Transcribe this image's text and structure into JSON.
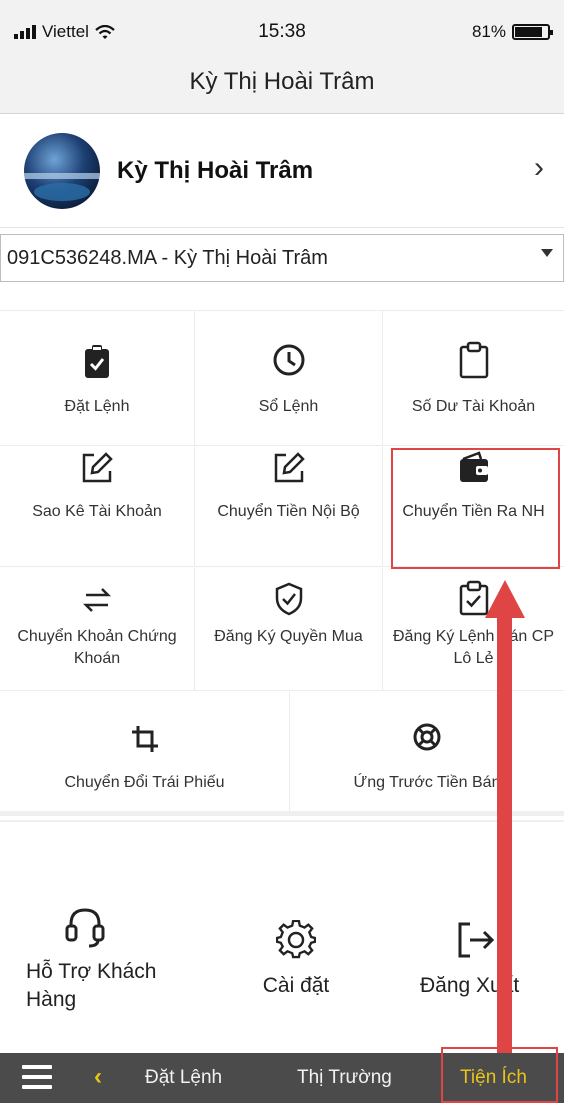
{
  "status_bar": {
    "carrier": "Viettel",
    "time": "15:38",
    "battery": "81%"
  },
  "header": {
    "title": "Kỳ Thị Hoài Trâm"
  },
  "profile": {
    "name": "Kỳ Thị Hoài Trâm"
  },
  "account": {
    "selected": "091C536248.MA - Kỳ Thị Hoài Trâm"
  },
  "grid": {
    "row1": [
      {
        "label": "Đặt Lệnh",
        "icon": "clipboard-check-icon"
      },
      {
        "label": "Sổ Lệnh",
        "icon": "clock-icon"
      },
      {
        "label": "Số Dư Tài Khoản",
        "icon": "clipboard-icon"
      }
    ],
    "row2": [
      {
        "label": "Sao Kê Tài Khoản",
        "icon": "edit-icon"
      },
      {
        "label": "Chuyển Tiền Nội Bộ",
        "icon": "edit-icon"
      },
      {
        "label": "Chuyển Tiền Ra NH",
        "icon": "wallet-icon"
      }
    ],
    "row3": [
      {
        "label": "Chuyển Khoản Chứng Khoán",
        "icon": "transfer-arrows-icon"
      },
      {
        "label": "Đăng Ký Quyền Mua",
        "icon": "shield-check-icon"
      },
      {
        "label": "Đăng Ký Lệnh Bán CP Lô Lẻ",
        "icon": "clipboard-check-outline-icon"
      }
    ],
    "row4": [
      {
        "label": "Chuyển Đổi Trái Phiếu",
        "icon": "crop-icon"
      },
      {
        "label": "Ứng Trước Tiền Bán",
        "icon": "lifebuoy-icon"
      }
    ]
  },
  "actions": {
    "support": {
      "label": "Hỗ Trợ Khách Hàng",
      "icon": "headset-icon"
    },
    "settings": {
      "label": "Cài đặt",
      "icon": "gear-icon"
    },
    "logout": {
      "label": "Đăng Xuất",
      "icon": "logout-icon"
    }
  },
  "tab_bar": {
    "tabs": [
      "Đặt Lệnh",
      "Thị Trường",
      "Tiện Ích"
    ],
    "active": "Tiện Ích"
  },
  "colors": {
    "tab_bar_bg": "#4b4b4b",
    "accent": "#e8c31b",
    "annotation": "#e04545"
  }
}
